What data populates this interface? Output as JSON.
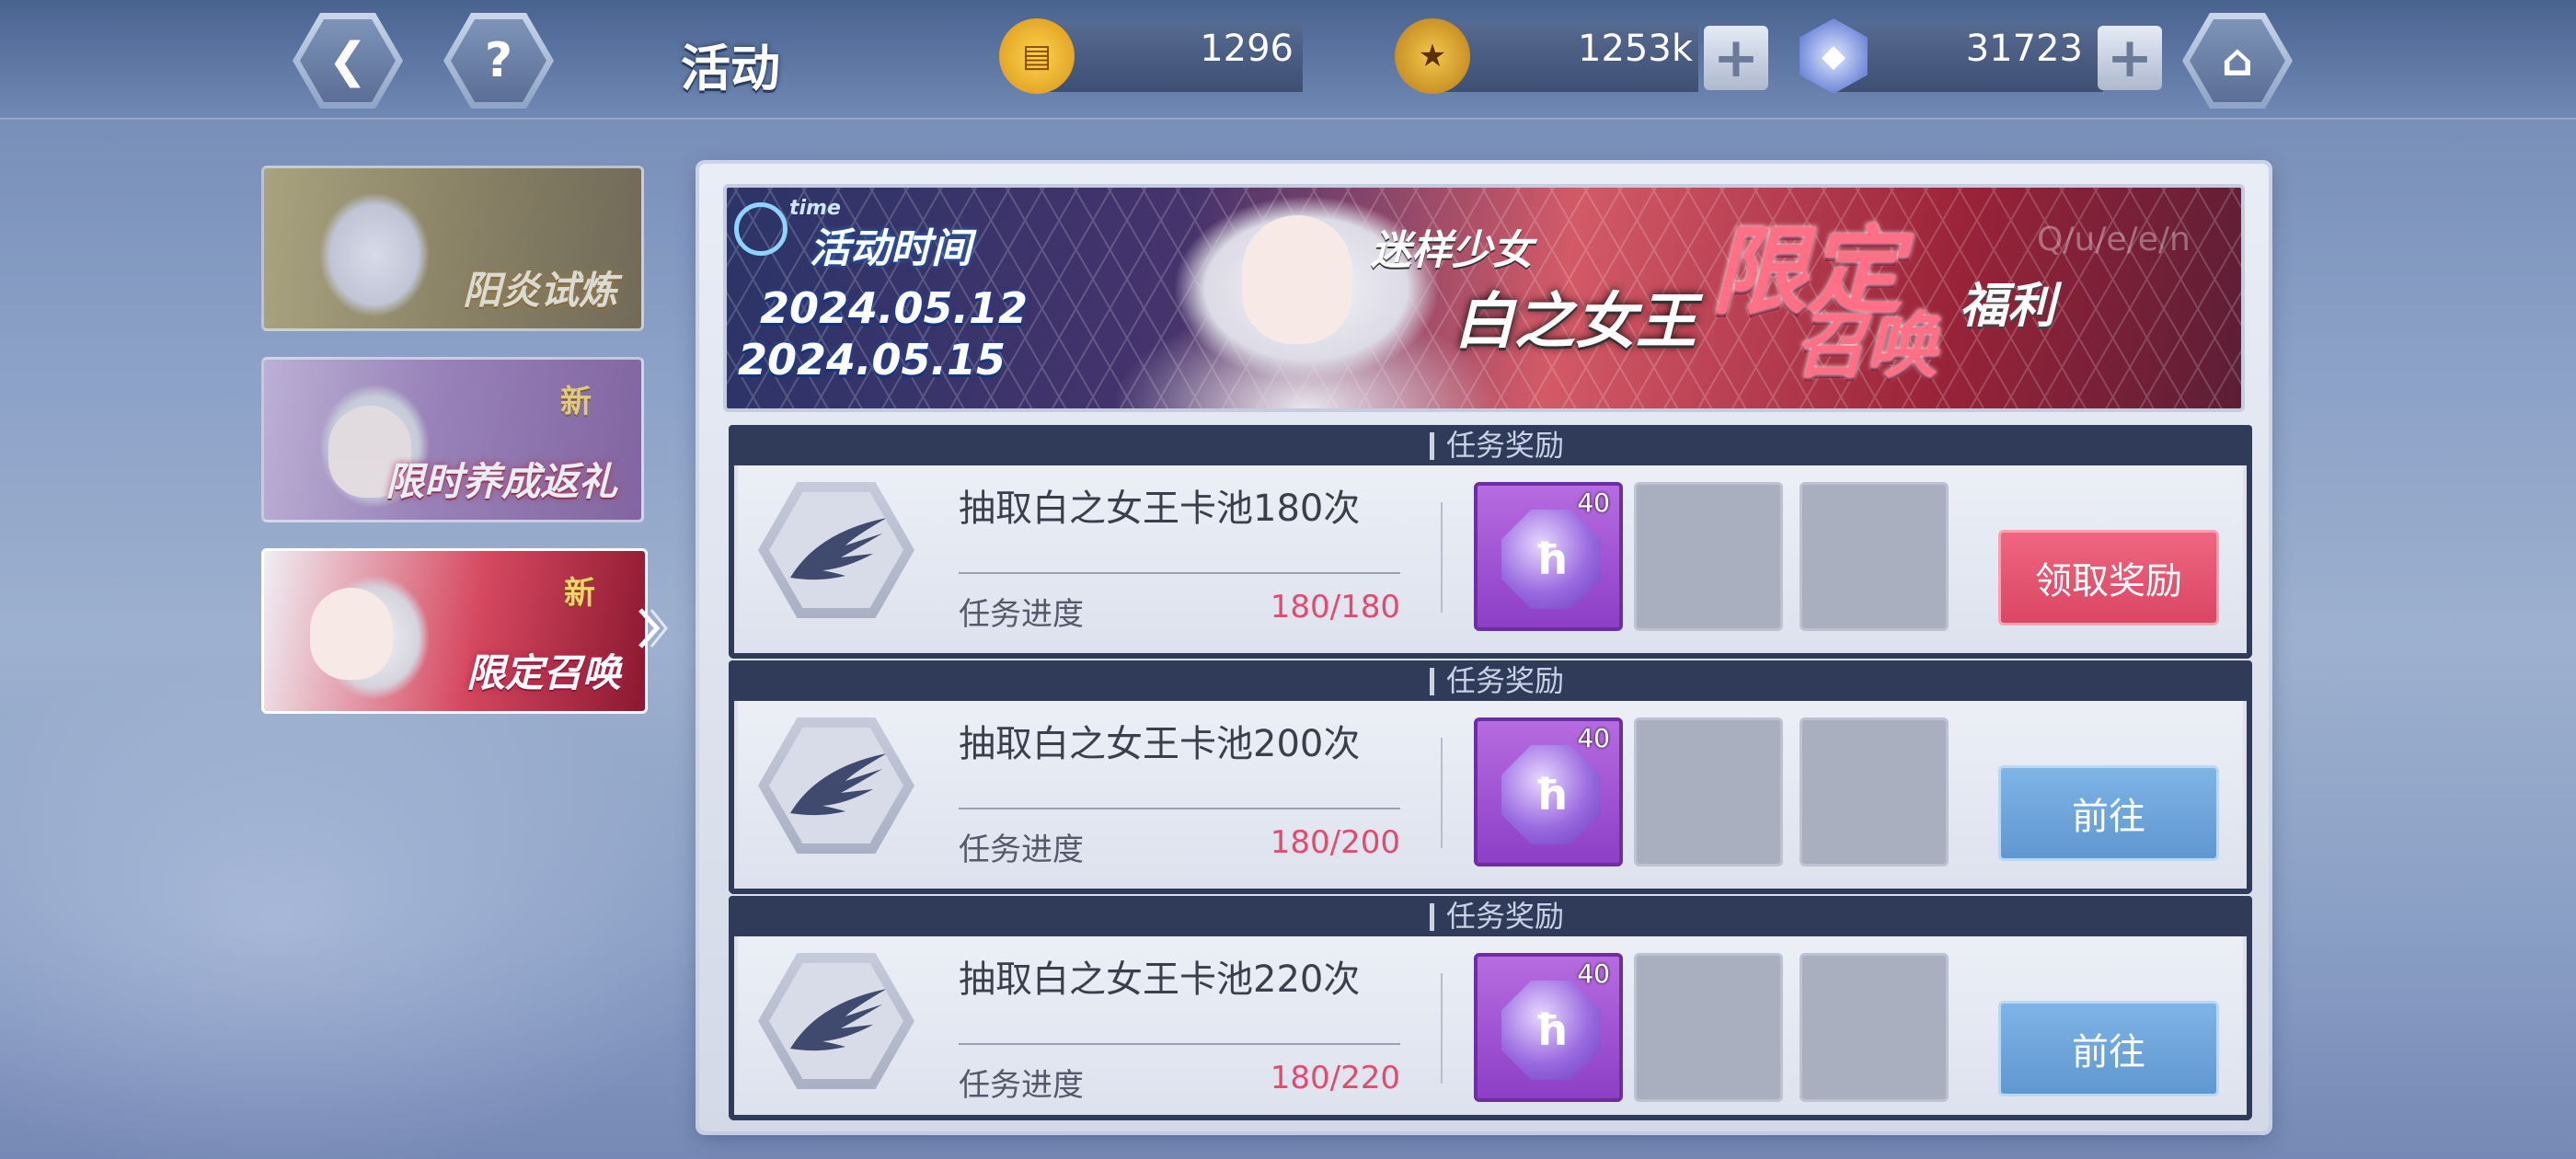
{
  "header": {
    "title": "活动",
    "back_icon": "back-arrow-icon",
    "help_icon": "question-icon",
    "home_icon": "home-icon"
  },
  "resources": [
    {
      "name": "gold-ingot-currency",
      "value": "1296"
    },
    {
      "name": "coin-currency",
      "value": "1253k"
    },
    {
      "name": "crystal-currency",
      "value": "31723"
    }
  ],
  "sidebar": {
    "items": [
      {
        "label": "阳炎试炼",
        "badge": ""
      },
      {
        "label": "限时养成返礼",
        "badge": "新"
      },
      {
        "label": "限定召唤",
        "badge": "新"
      }
    ]
  },
  "banner": {
    "time_tag": "time",
    "heading": "活动时间",
    "start_date": "2024.05.12",
    "end_date": "2024.05.15",
    "subtitle": "迷样少女",
    "name": "白之女王",
    "tag1": "限定",
    "tag2": "召唤",
    "tag3": "福利",
    "watermark": "Q/u/e/e/n"
  },
  "tasks": [
    {
      "section": "任务奖励",
      "title": "抽取白之女王卡池180次",
      "progress_label": "任务进度",
      "progress": "180/180",
      "reward_count": "40",
      "reward_symbol": "ħ",
      "action": "领取奖励",
      "action_type": "claim"
    },
    {
      "section": "任务奖励",
      "title": "抽取白之女王卡池200次",
      "progress_label": "任务进度",
      "progress": "180/200",
      "reward_count": "40",
      "reward_symbol": "ħ",
      "action": "前往",
      "action_type": "go"
    },
    {
      "section": "任务奖励",
      "title": "抽取白之女王卡池220次",
      "progress_label": "任务进度",
      "progress": "180/220",
      "reward_count": "40",
      "reward_symbol": "ħ",
      "action": "前往",
      "action_type": "go"
    }
  ],
  "colors": {
    "accent_pink": "#e24a6f",
    "claim_button": "#d94663",
    "go_button": "#5f97d0",
    "header_dark": "#2f3b58"
  }
}
